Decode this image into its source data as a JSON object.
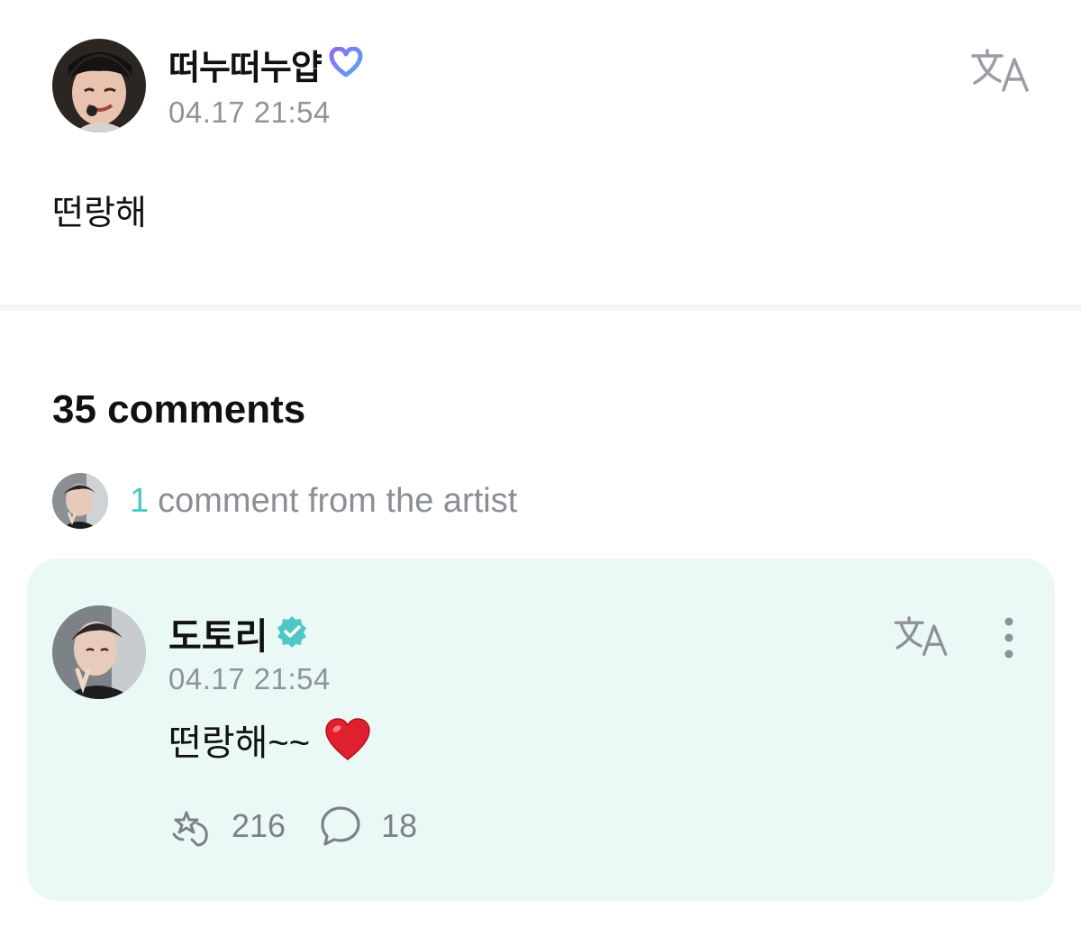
{
  "post": {
    "author": "떠누떠누얍",
    "time": "04.17 21:54",
    "body": "떤랑해"
  },
  "comments": {
    "count_label": "35 comments",
    "artist_count": "1",
    "artist_label": "comment from the artist"
  },
  "artist_comment": {
    "author": "도토리",
    "time": "04.17 21:54",
    "body": "떤랑해~~",
    "likes": "216",
    "replies": "18"
  },
  "icons": {
    "post_badge": "membership-heart-icon",
    "artist_badge": "verified-badge-icon",
    "translate": "translate-icon",
    "more": "more-vertical-icon",
    "like": "like-icon",
    "reply": "comment-bubble-icon",
    "emoji": "red-heart-emoji"
  },
  "colors": {
    "accent": "#4fc7c6",
    "card_bg": "#eaf8f6",
    "muted_text": "#8f939a",
    "heart": "#e0202e"
  }
}
